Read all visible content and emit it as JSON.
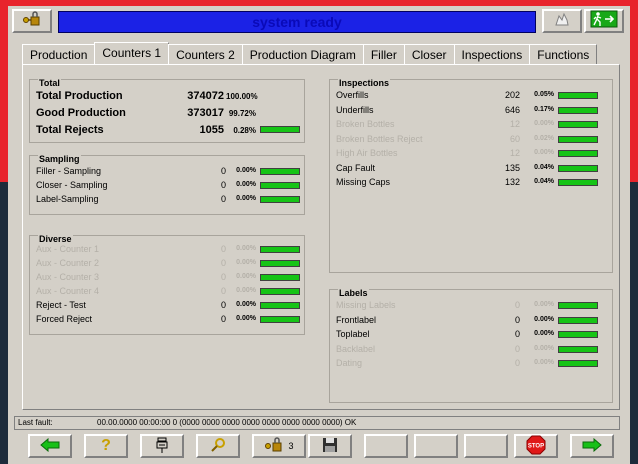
{
  "status": "system ready",
  "tabs": [
    "Production",
    "Counters 1",
    "Counters 2",
    "Production Diagram",
    "Filler",
    "Closer",
    "Inspections",
    "Functions"
  ],
  "active_tab": "Counters 1",
  "total": {
    "title": "Total",
    "rows": [
      {
        "label": "Total Production",
        "value": "374072",
        "pct": "100.00%"
      },
      {
        "label": "Good Production",
        "value": "373017",
        "pct": "99.72%"
      },
      {
        "label": "Total Rejects",
        "value": "1055",
        "pct": "0.28%"
      }
    ]
  },
  "sampling": {
    "title": "Sampling",
    "rows": [
      {
        "label": "Filler - Sampling",
        "value": "0",
        "pct": "0.00%"
      },
      {
        "label": "Closer - Sampling",
        "value": "0",
        "pct": "0.00%"
      },
      {
        "label": "Label-Sampling",
        "value": "0",
        "pct": "0.00%"
      }
    ]
  },
  "diverse": {
    "title": "Diverse",
    "rows": [
      {
        "label": "Aux - Counter 1",
        "value": "0",
        "pct": "0.00%",
        "dim": true
      },
      {
        "label": "Aux - Counter 2",
        "value": "0",
        "pct": "0.00%",
        "dim": true
      },
      {
        "label": "Aux - Counter 3",
        "value": "0",
        "pct": "0.00%",
        "dim": true
      },
      {
        "label": "Aux - Counter 4",
        "value": "0",
        "pct": "0.00%",
        "dim": true
      },
      {
        "label": "Reject - Test",
        "value": "0",
        "pct": "0.00%",
        "dim": false
      },
      {
        "label": "Forced Reject",
        "value": "0",
        "pct": "0.00%",
        "dim": false
      }
    ]
  },
  "inspections": {
    "title": "Inspections",
    "rows": [
      {
        "label": "Overfills",
        "value": "202",
        "pct": "0.05%",
        "dim": false
      },
      {
        "label": "Underfills",
        "value": "646",
        "pct": "0.17%",
        "dim": false
      },
      {
        "label": "Broken Bottles",
        "value": "12",
        "pct": "0.00%",
        "dim": true
      },
      {
        "label": "Broken Bottles Reject",
        "value": "60",
        "pct": "0.02%",
        "dim": true
      },
      {
        "label": "High Air Bottles",
        "value": "12",
        "pct": "0.00%",
        "dim": true
      },
      {
        "label": "Cap Fault",
        "value": "135",
        "pct": "0.04%",
        "dim": false
      },
      {
        "label": "Missing Caps",
        "value": "132",
        "pct": "0.04%",
        "dim": false
      }
    ]
  },
  "labels": {
    "title": "Labels",
    "rows": [
      {
        "label": "Missing Labels",
        "value": "0",
        "pct": "0.00%",
        "dim": true
      },
      {
        "label": "Frontlabel",
        "value": "0",
        "pct": "0.00%",
        "dim": false
      },
      {
        "label": "Toplabel",
        "value": "0",
        "pct": "0.00%",
        "dim": false
      },
      {
        "label": "Backlabel",
        "value": "0",
        "pct": "0.00%",
        "dim": true
      },
      {
        "label": "Dating",
        "value": "0",
        "pct": "0.00%",
        "dim": true
      }
    ]
  },
  "fault": {
    "label": "Last fault:",
    "text": "00.00.0000 00:00:00  0  (0000 0000 0000 0000 0000 0000 0000 0000) OK"
  },
  "toolbar": {
    "user_level": "3"
  },
  "colors": {
    "status_bar": "#1b22e6",
    "bar_fill": "#16c416",
    "panel": "#d4d0c8",
    "dim_text": "#b4b0a8"
  }
}
